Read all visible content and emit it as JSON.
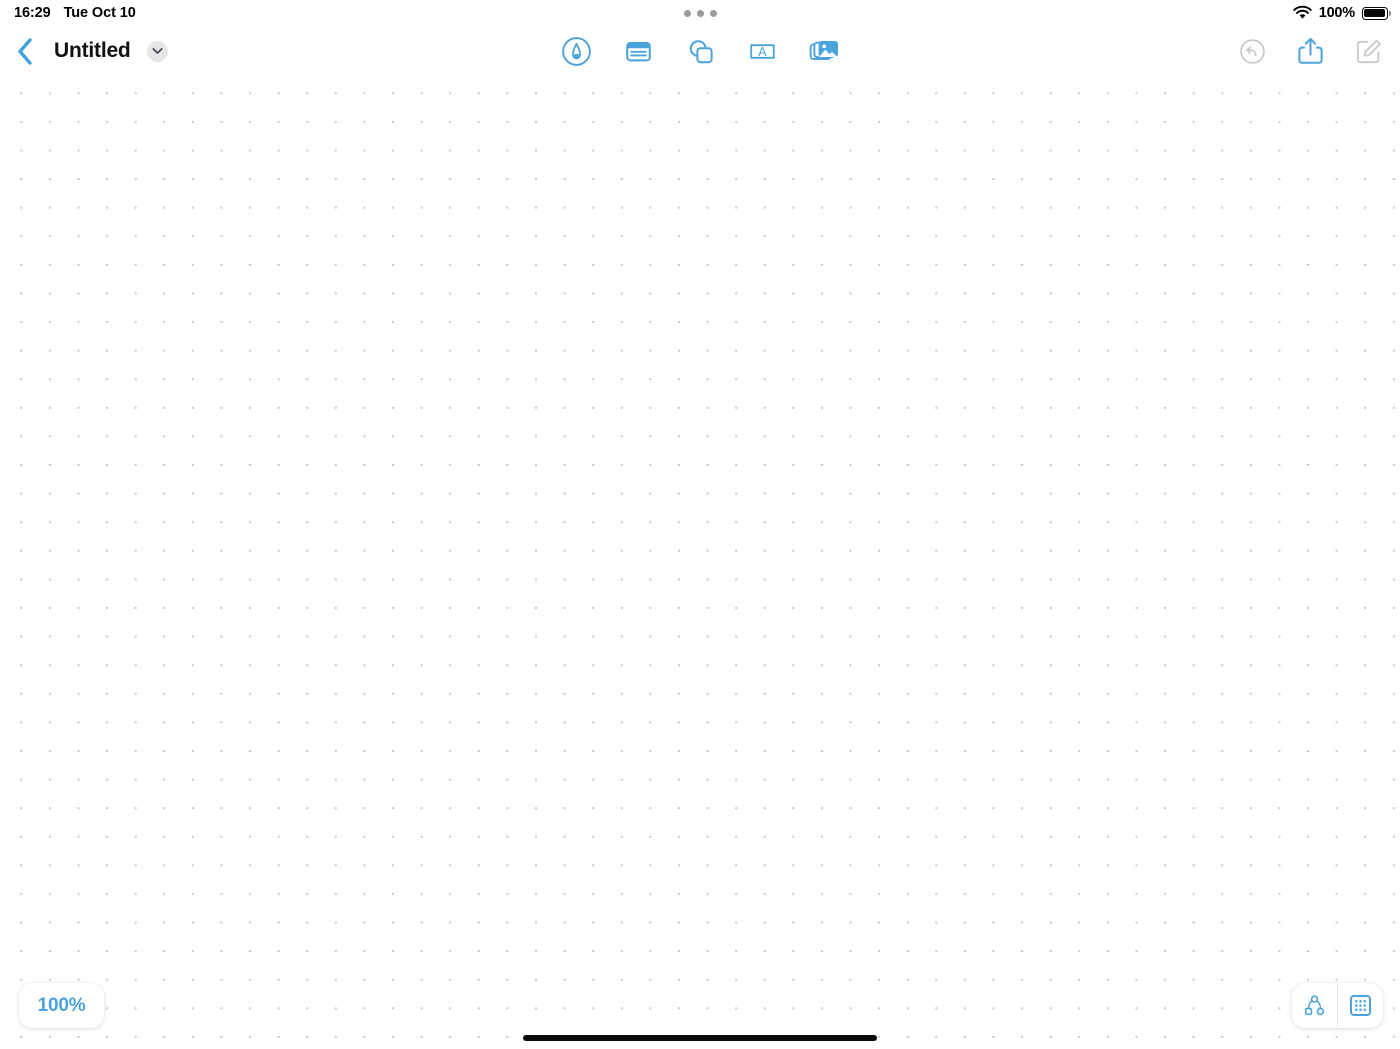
{
  "status_bar": {
    "time": "16:29",
    "date": "Tue Oct 10",
    "battery_percent": "100%",
    "wifi_icon": "wifi-icon",
    "battery_icon": "battery-full-icon",
    "multitask_handle_icon": "multitask-handle-icon"
  },
  "navbar": {
    "back_icon": "chevron-left-icon",
    "title": "Untitled",
    "title_menu_icon": "chevron-down-icon",
    "tools": [
      {
        "name": "pen-tool",
        "icon": "pen-circle-icon",
        "label": "Draw",
        "active": true
      },
      {
        "name": "note-tool",
        "icon": "note-card-icon",
        "label": "Note",
        "active": true
      },
      {
        "name": "shapes-tool",
        "icon": "shapes-icon",
        "label": "Shapes",
        "active": true
      },
      {
        "name": "text-tool",
        "icon": "text-box-icon",
        "label": "Text",
        "active": true
      },
      {
        "name": "image-tool",
        "icon": "photos-icon",
        "label": "Image",
        "active": true
      }
    ],
    "actions": [
      {
        "name": "undo",
        "icon": "undo-circle-icon",
        "label": "Undo",
        "enabled": false
      },
      {
        "name": "share",
        "icon": "share-up-icon",
        "label": "Share",
        "enabled": true
      },
      {
        "name": "edit",
        "icon": "compose-square-icon",
        "label": "Edit",
        "enabled": false
      }
    ]
  },
  "canvas": {
    "background": "dot-grid",
    "dot_color": "#c9c9cf",
    "dot_spacing_px": 28,
    "content": ""
  },
  "floating_controls": {
    "zoom_level": "100%",
    "corner_buttons": [
      {
        "name": "mindmap-view",
        "icon": "node-graph-icon",
        "label": "Mind Map"
      },
      {
        "name": "grid-view",
        "icon": "grid-icon",
        "label": "Grid"
      }
    ]
  },
  "colors": {
    "accent_blue": "#4aa3db",
    "back_blue": "#3ea0dc",
    "disabled_grey": "#c8c8cc",
    "dot_grey": "#c9c9cf",
    "title_black": "#111111"
  },
  "home_indicator": "home-indicator"
}
